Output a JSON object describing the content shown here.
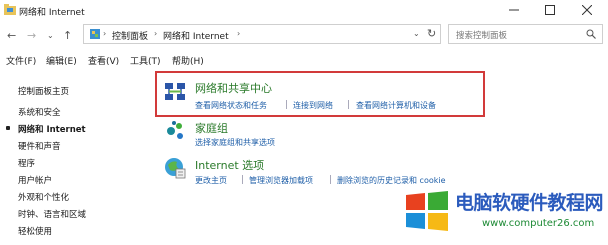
{
  "window": {
    "title": "网络和 Internet",
    "minimize_icon": "minimize-icon",
    "maximize_icon": "maximize-icon",
    "close_icon": "close-icon"
  },
  "nav": {
    "breadcrumb": [
      "控制面板",
      "网络和 Internet"
    ],
    "search_placeholder": "搜索控制面板"
  },
  "menu": [
    "文件(F)",
    "编辑(E)",
    "查看(V)",
    "工具(T)",
    "帮助(H)"
  ],
  "sidebar": {
    "home": "控制面板主页",
    "items": [
      {
        "label": "系统和安全",
        "active": false
      },
      {
        "label": "网络和 Internet",
        "active": true
      },
      {
        "label": "硬件和声音",
        "active": false
      },
      {
        "label": "程序",
        "active": false
      },
      {
        "label": "用户帐户",
        "active": false
      },
      {
        "label": "外观和个性化",
        "active": false
      },
      {
        "label": "时钟、语言和区域",
        "active": false
      },
      {
        "label": "轻松使用",
        "active": false
      }
    ]
  },
  "categories": [
    {
      "title": "网络和共享中心",
      "icon": "network-sharing-icon",
      "links": [
        "查看网络状态和任务",
        "连接到网络",
        "查看网络计算机和设备"
      ]
    },
    {
      "title": "家庭组",
      "icon": "homegroup-icon",
      "links": [
        "选择家庭组和共享选项"
      ]
    },
    {
      "title": "Internet 选项",
      "icon": "internet-options-icon",
      "links": [
        "更改主页",
        "管理浏览器加载项",
        "删除浏览的历史记录和 cookie"
      ]
    }
  ],
  "watermark": {
    "title": "电脑软硬件教程网",
    "url": "www.computer26.com",
    "colors": {
      "red": "#e8411f",
      "blue": "#1b8fd8",
      "green": "#3aaa35",
      "yellow": "#f6b915"
    }
  },
  "colors": {
    "highlight": "#d23a3a",
    "link": "#1f5fa8",
    "category_title": "#2a7a2a"
  }
}
